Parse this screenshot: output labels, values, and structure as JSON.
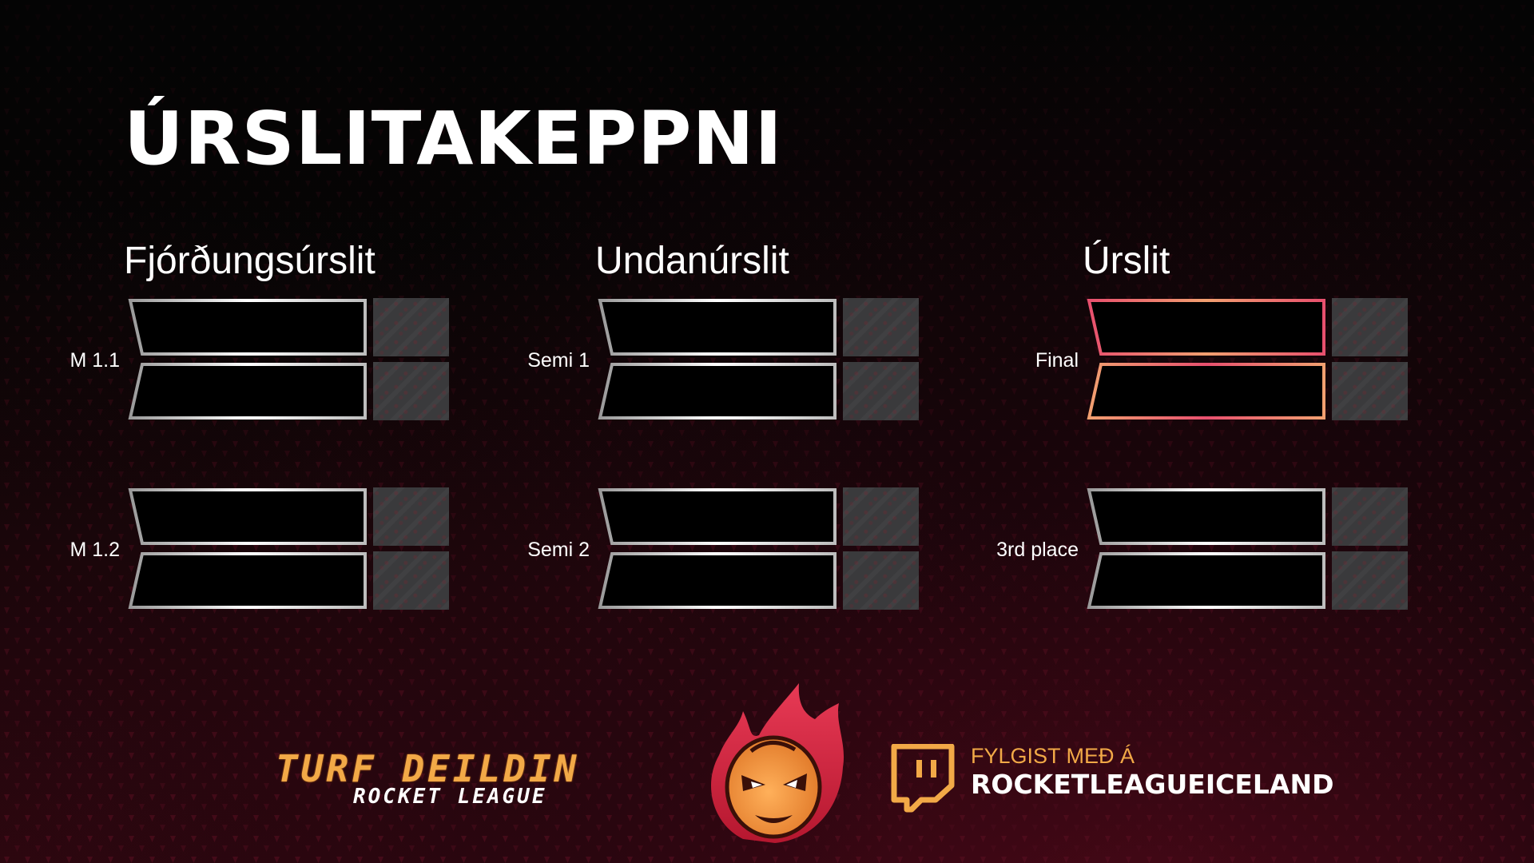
{
  "title": "ÚRSLITAKEPPNI",
  "rounds": [
    {
      "title": "Fjórðungsúrslit",
      "matches": [
        {
          "label": "M 1.1"
        },
        {
          "label": "M 1.2"
        }
      ]
    },
    {
      "title": "Undanúrslit",
      "matches": [
        {
          "label": "Semi 1"
        },
        {
          "label": "Semi 2"
        }
      ]
    },
    {
      "title": "Úrslit",
      "matches": [
        {
          "label": "Final"
        },
        {
          "label": "3rd place"
        }
      ]
    }
  ],
  "footer": {
    "league_line1": "TURF DEILDIN",
    "league_line2": "ROCKET LEAGUE",
    "follow_label": "FYLGIST MEÐ Á",
    "channel": "ROCKETLEAGUEICELAND",
    "platform_icon": "twitch-icon",
    "mascot_icon": "fire-mascot-icon"
  },
  "colors": {
    "accent_orange": "#f2a947",
    "final_gradient_start": "#e8506e",
    "final_gradient_end": "#f2a070",
    "slot_border": "#d8d8d8",
    "score_box": "#3a3a3c"
  }
}
